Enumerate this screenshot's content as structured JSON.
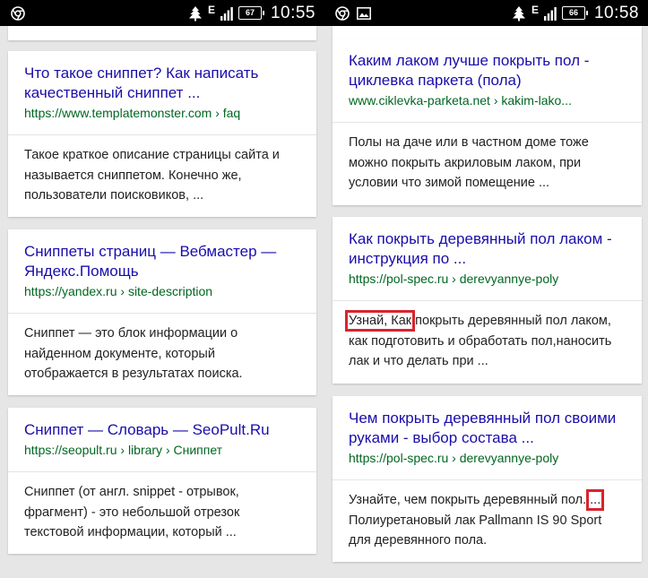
{
  "left_phone": {
    "status": {
      "net": "E",
      "battery": "67",
      "time": "10:55"
    },
    "results": [
      {
        "title": "Что такое сниппет? Как написать качественный сниппет ...",
        "url": "https://www.templatemonster.com › faq",
        "snippet": "Такое краткое описание страницы сайта и называется сниппетом. Конечно же, пользователи поисковиков, ..."
      },
      {
        "title": "Сниппеты страниц — Вебмастер — Яндекс.Помощь",
        "url": "https://yandex.ru › site-description",
        "snippet": "Сниппет — это блок информации о найденном документе, который отображается в результатах поиска."
      },
      {
        "title": "Сниппет — Словарь — SeoPult.Ru",
        "url": "https://seopult.ru › library › Сниппет",
        "snippet": "Сниппет (от англ. snippet - отрывок, фрагмент) - это небольшой отрезок текстовой информации, который ..."
      }
    ]
  },
  "right_phone": {
    "status": {
      "net": "E",
      "battery": "66",
      "time": "10:58"
    },
    "results": [
      {
        "title": "Каким лаком лучше покрыть пол - циклевка паркета (пола)",
        "url": "www.ciklevka-parketa.net › kakim-lako...",
        "snippet": "Полы на даче или в частном доме тоже можно покрыть акриловым лаком, при условии что зимой помещение ..."
      },
      {
        "title": "Как покрыть деревянный пол лаком - инструкция по ...",
        "url": "https://pol-spec.ru › derevyannye-poly",
        "snippet_highlight": "Узнай, Как",
        "snippet_rest": " покрыть деревянный пол лаком, как подготовить и обработать пол,наносить лак и что делать при ..."
      },
      {
        "title": "Чем покрыть деревянный пол своими руками - выбор состава ...",
        "url": "https://pol-spec.ru › derevyannye-poly",
        "snippet_start": "Узнайте, чем покрыть деревянный пол. ",
        "snippet_highlight": "...",
        "snippet_rest": " Полиуретановый лак Pallmann IS 90 Sport для деревянного пола."
      }
    ]
  },
  "colors": {
    "title": "#1a0dab",
    "url": "#006621",
    "highlight": "#d9232e",
    "background": "#e6e6e6"
  }
}
